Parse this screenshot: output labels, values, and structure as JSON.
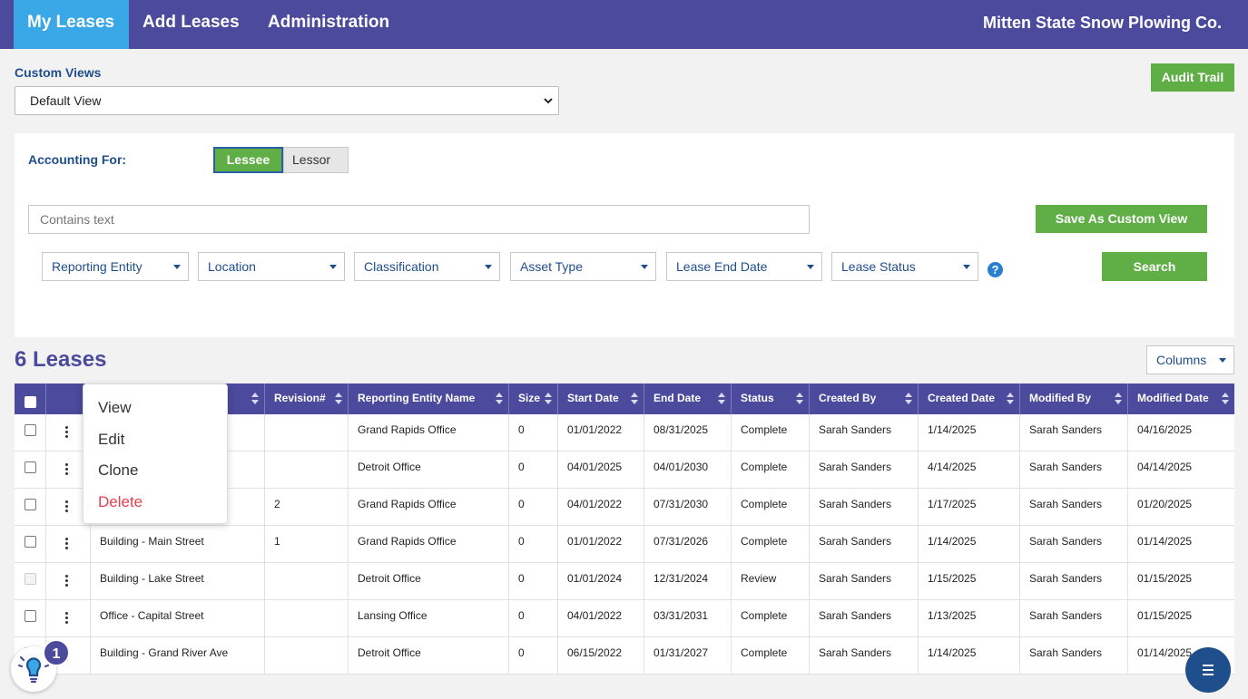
{
  "nav": {
    "tabs": [
      "My Leases",
      "Add Leases",
      "Administration"
    ],
    "company": "Mitten State Snow Plowing Co."
  },
  "custom_views": {
    "label": "Custom Views",
    "selected": "Default View"
  },
  "audit_trail": "Audit Trail",
  "accounting": {
    "label": "Accounting For:",
    "lessee": "Lessee",
    "lessor": "Lessor"
  },
  "search": {
    "placeholder": "Contains text",
    "save_view": "Save As Custom View",
    "button": "Search"
  },
  "filters": [
    "Reporting Entity",
    "Location",
    "Classification",
    "Asset Type",
    "Lease End Date",
    "Lease Status"
  ],
  "help": "?",
  "leases_title": "6 Leases",
  "columns_button": "Columns",
  "table": {
    "headers": [
      "",
      "Revision#",
      "Reporting Entity Name",
      "Size",
      "Start Date",
      "End Date",
      "Status",
      "Created By",
      "Created Date",
      "Modified By",
      "Modified Date"
    ],
    "rows": [
      [
        "",
        "",
        "Grand Rapids Office",
        "0",
        "01/01/2022",
        "08/31/2025",
        "Complete",
        "Sarah Sanders",
        "1/14/2025",
        "Sarah Sanders",
        "04/16/2025"
      ],
      [
        "",
        "",
        "Detroit Office",
        "0",
        "04/01/2025",
        "04/01/2030",
        "Complete",
        "Sarah Sanders",
        "4/14/2025",
        "Sarah Sanders",
        "04/14/2025"
      ],
      [
        "",
        "2",
        "Grand Rapids Office",
        "0",
        "04/01/2022",
        "07/31/2030",
        "Complete",
        "Sarah Sanders",
        "1/17/2025",
        "Sarah Sanders",
        "01/20/2025"
      ],
      [
        "Building - Main Street",
        "1",
        "Grand Rapids Office",
        "0",
        "01/01/2022",
        "07/31/2026",
        "Complete",
        "Sarah Sanders",
        "1/14/2025",
        "Sarah Sanders",
        "01/14/2025"
      ],
      [
        "Building - Lake Street",
        "",
        "Detroit Office",
        "0",
        "01/01/2024",
        "12/31/2024",
        "Review",
        "Sarah Sanders",
        "1/15/2025",
        "Sarah Sanders",
        "01/15/2025"
      ],
      [
        "Office - Capital Street",
        "",
        "Lansing Office",
        "0",
        "04/01/2022",
        "03/31/2031",
        "Complete",
        "Sarah Sanders",
        "1/13/2025",
        "Sarah Sanders",
        "01/15/2025"
      ],
      [
        "Building - Grand River Ave",
        "",
        "Detroit Office",
        "0",
        "06/15/2022",
        "01/31/2027",
        "Complete",
        "Sarah Sanders",
        "1/14/2025",
        "Sarah Sanders",
        "01/14/2025"
      ]
    ]
  },
  "context_menu": [
    "View",
    "Edit",
    "Clone",
    "Delete"
  ],
  "notification_count": "1",
  "colors": {
    "nav": "#4b4a9c",
    "active_tab": "#3aa7e6",
    "green": "#5fae46",
    "danger": "#e0414d"
  }
}
